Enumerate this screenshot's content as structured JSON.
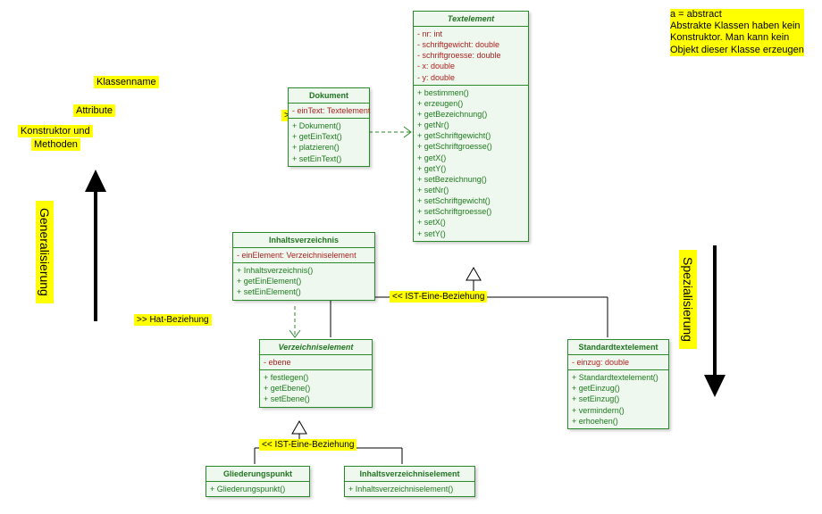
{
  "legend": {
    "klassenname": "Klassenname",
    "attribute": "Attribute",
    "konstruktor": "Konstruktor und",
    "methoden": "Methoden"
  },
  "side": {
    "general": "Generalisierung",
    "spezial": "Spezialisierung"
  },
  "annot": {
    "hat1": ">> Hat-Beziehung",
    "hat2": ">> Hat-Beziehung",
    "ist1": "<< IST-Eine-Beziehung",
    "ist2": "<< IST-Eine-Beziehung",
    "abs1": "a = abstract",
    "abs2": "a = abstract"
  },
  "note": {
    "l1": "a = abstract",
    "l2": "Abstrakte Klassen haben kein",
    "l3": "Konstruktor. Man kann kein",
    "l4": "Objekt dieser Klasse erzeugen"
  },
  "cls": {
    "textelement": {
      "title": "Textelement",
      "attrs": [
        "- nr: int",
        "- schriftgewicht: double",
        "- schriftgroesse: double",
        "- x: double",
        "- y: double"
      ],
      "meth": [
        "+  bestimmen()",
        "+  erzeugen()",
        "+  getBezeichnung()",
        "+  getNr()",
        "+  getSchriftgewicht()",
        "+  getSchriftgroesse()",
        "+  getX()",
        "+  getY()",
        "+  setBezeichnung()",
        "+  setNr()",
        "+  setSchriftgewicht()",
        "+  setSchriftgroesse()",
        "+  setX()",
        "+  setY()"
      ]
    },
    "dokument": {
      "title": "Dokument",
      "attrs": [
        "- einText: Textelement"
      ],
      "meth": [
        "+  Dokument()",
        "+  getEinText()",
        "+  platzieren()",
        "+  setEinText()"
      ]
    },
    "inhaltsverz": {
      "title": "Inhaltsverzeichnis",
      "attrs": [
        "- einElement: Verzeichniselement"
      ],
      "meth": [
        "+  Inhaltsverzeichnis()",
        "+  getEinElement()",
        "+  setEinElement()"
      ]
    },
    "verzelem": {
      "title": "Verzeichniselement",
      "attrs": [
        "- ebene"
      ],
      "meth": [
        "+  festlegen()",
        "+  getEbene()",
        "+  setEbene()"
      ]
    },
    "standardtext": {
      "title": "Standardtextelement",
      "attrs": [
        "- einzug: double"
      ],
      "meth": [
        "+  Standardtextelement()",
        "+  getEinzug()",
        "+  setEinzug()",
        "+  vermindern()",
        "+  erhoehen()"
      ]
    },
    "gliederung": {
      "title": "Gliederungspunkt",
      "meth": [
        "+  Gliederungspunkt()"
      ]
    },
    "ive": {
      "title": "Inhaltsverzeichniselement",
      "meth": [
        "+  Inhaltsverzeichniselement()"
      ]
    }
  }
}
